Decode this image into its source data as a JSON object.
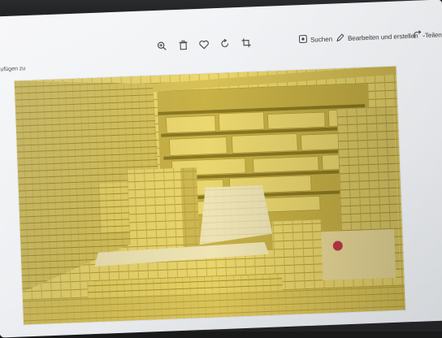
{
  "toolbar": {
    "zoom_icon": "zoom-in-icon",
    "delete_icon": "trash-icon",
    "favorite_icon": "heart-icon",
    "rotate_icon": "rotate-icon",
    "crop_icon": "crop-icon",
    "search_label": "Suchen",
    "edit_label": "Bearbeiten und erstellen",
    "share_label": "Teilen"
  },
  "left_label": "nzufügen zu",
  "photo": {
    "subject": "post-it-notes-room"
  },
  "colors": {
    "note_yellow": "#e9d46a",
    "note_shadow": "#b8a23a",
    "background": "#eceef1"
  }
}
